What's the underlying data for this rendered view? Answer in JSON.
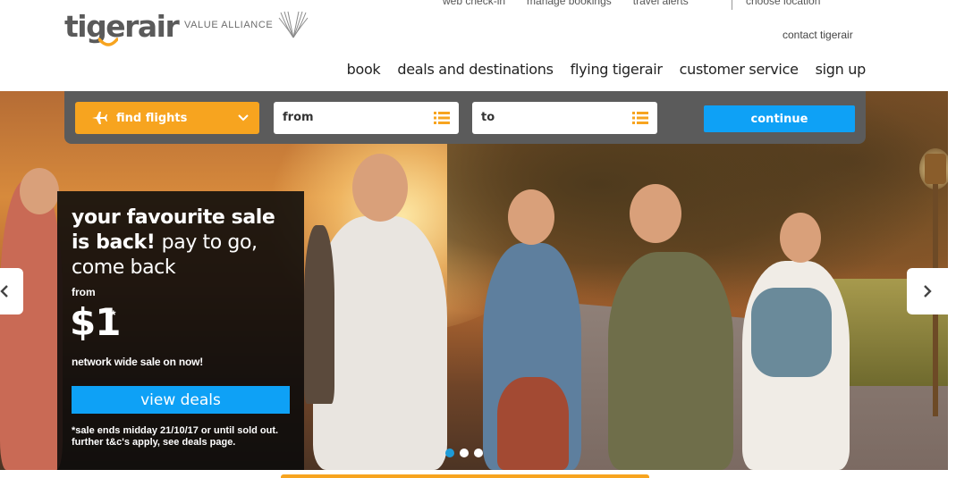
{
  "brand": {
    "logo_text": "tigerair",
    "alliance_text": "VALUE ALLIANCE",
    "accent_color": "#f7a41f",
    "button_color": "#0ea1f6"
  },
  "topnav": {
    "items": [
      "web check-in",
      "manage bookings",
      "travel alerts"
    ],
    "choose_location": "choose location",
    "contact": "contact tigerair"
  },
  "mainnav": {
    "items": [
      "book",
      "deals and destinations",
      "flying tigerair",
      "customer service",
      "sign up"
    ]
  },
  "search": {
    "find_flights": "find flights",
    "from_label": "from",
    "to_label": "to",
    "continue_label": "continue"
  },
  "promo": {
    "headline_bold": "your favourite sale is back!",
    "headline_light": "pay to go, come back",
    "from_label": "from",
    "price": "$1",
    "price_mark": "*",
    "subtitle": "network wide sale on now!",
    "cta_label": "view deals",
    "note": "*sale ends midday 21/10/17 or until sold out. further t&c's apply, see deals page."
  },
  "carousel": {
    "slide_count": 3,
    "active_slide": 1,
    "prev_icon": "chevron-left-icon",
    "next_icon": "chevron-right-icon"
  }
}
